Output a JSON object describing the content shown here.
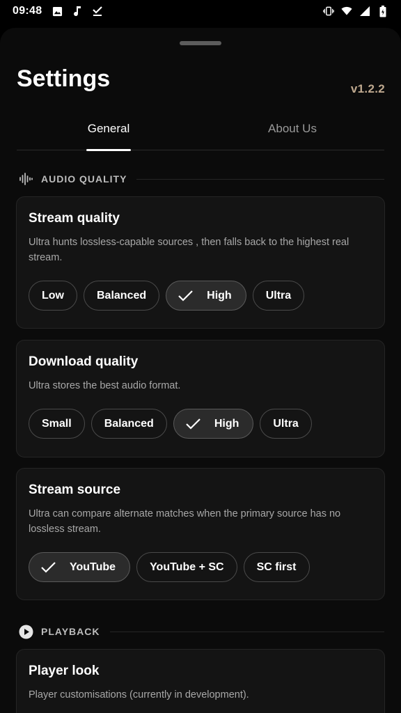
{
  "status_bar": {
    "time": "09:48",
    "left_icons": [
      "image-icon",
      "music-note-icon",
      "download-done-icon"
    ],
    "right_icons": [
      "vibrate-icon",
      "wifi-icon",
      "signal-icon",
      "battery-icon"
    ]
  },
  "header": {
    "title": "Settings",
    "version": "v1.2.2"
  },
  "tabs": [
    {
      "label": "General",
      "active": true
    },
    {
      "label": "About Us",
      "active": false
    }
  ],
  "sections": {
    "audio_quality": {
      "label": "AUDIO QUALITY",
      "icon": "waveform-icon"
    },
    "playback": {
      "label": "PLAYBACK",
      "icon": "play-circle-icon"
    }
  },
  "cards": {
    "stream_quality": {
      "title": "Stream quality",
      "description": "Ultra hunts lossless-capable sources , then falls back to the highest real stream.",
      "options": [
        "Low",
        "Balanced",
        "High",
        "Ultra"
      ],
      "selected": "High"
    },
    "download_quality": {
      "title": "Download quality",
      "description": "Ultra stores the best audio format.",
      "options": [
        "Small",
        "Balanced",
        "High",
        "Ultra"
      ],
      "selected": "High"
    },
    "stream_source": {
      "title": "Stream source",
      "description": "Ultra can compare alternate matches when the primary source has no lossless stream.",
      "options": [
        "YouTube",
        "YouTube + SC",
        "SC first"
      ],
      "selected": "YouTube"
    },
    "player_look": {
      "title": "Player look",
      "description": "Player customisations (currently in development)."
    }
  },
  "colors": {
    "background": "#000000",
    "sheet": "#0b0b0b",
    "card": "#141414",
    "version_accent": "#bfa98f",
    "chip_selected": "#2b2b2b"
  }
}
